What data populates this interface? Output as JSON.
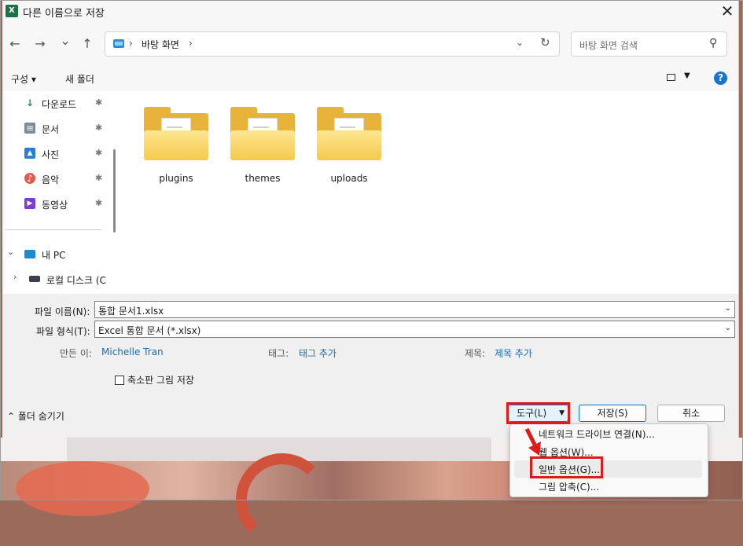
{
  "window": {
    "title": "다른 이름으로 저장",
    "app_icon": "excel-icon",
    "close_glyph": "✕"
  },
  "nav": {
    "back_glyph": "←",
    "forward_glyph": "→",
    "recent_glyph": "⌄",
    "up_glyph": "↑",
    "address": {
      "sep": "›",
      "location": "바탕 화면",
      "dd_glyph": "⌄",
      "refresh_glyph": "↻"
    },
    "search_placeholder": "바탕 화면 검색",
    "search_glyph": "⚲"
  },
  "commands": {
    "organize": "구성 ▾",
    "new_folder": "새 폴더",
    "view_dd": "▼",
    "help": "?"
  },
  "sidebar": {
    "quick_access": [
      {
        "label": "다운로드",
        "icon": "download-icon",
        "glyph": "↓",
        "color": "#1e8e5a"
      },
      {
        "label": "문서",
        "icon": "document-icon",
        "glyph": "≡",
        "color": "#7c8a99"
      },
      {
        "label": "사진",
        "icon": "pictures-icon",
        "glyph": "▲",
        "color": "#2b7fd0"
      },
      {
        "label": "음악",
        "icon": "music-icon",
        "glyph": "♪",
        "color": "#e05a4a"
      },
      {
        "label": "동영상",
        "icon": "video-icon",
        "glyph": "▶",
        "color": "#7b3fd0"
      }
    ],
    "pin_glyph": "📌",
    "this_pc": {
      "label": "내 PC",
      "chevron": "⌄"
    },
    "local_disk": {
      "label": "로컬 디스크 (C",
      "chevron": "›"
    }
  },
  "folders": [
    {
      "name": "plugins"
    },
    {
      "name": "themes"
    },
    {
      "name": "uploads"
    }
  ],
  "form": {
    "filename_label": "파일 이름(N):",
    "filename_value": "통합 문서1.xlsx",
    "filetype_label": "파일 형식(T):",
    "filetype_value": "Excel 통합 문서 (*.xlsx)",
    "dd_glyph": "⌄",
    "author_label": "만든 이:",
    "author_value": "Michelle Tran",
    "tags_label": "태그:",
    "tags_value": "태그 추가",
    "title_label": "제목:",
    "title_value": "제목 추가",
    "thumbnail_label": "축소판 그림 저장"
  },
  "bottom": {
    "hide_folders": "⌃ 폴더 숨기기",
    "tools_label": "도구(L)",
    "tools_dd": "▼",
    "save_label": "저장(S)",
    "cancel_label": "취소"
  },
  "tools_menu": {
    "items": [
      "네트워크 드라이브 연결(N)...",
      "웹 옵션(W)...",
      "일반 옵션(G)...",
      "그림 압축(C)..."
    ],
    "highlighted_index": 2
  },
  "colors": {
    "accent": "#0078d4",
    "highlight_box": "#e01919",
    "folder": "#f5c94c"
  }
}
